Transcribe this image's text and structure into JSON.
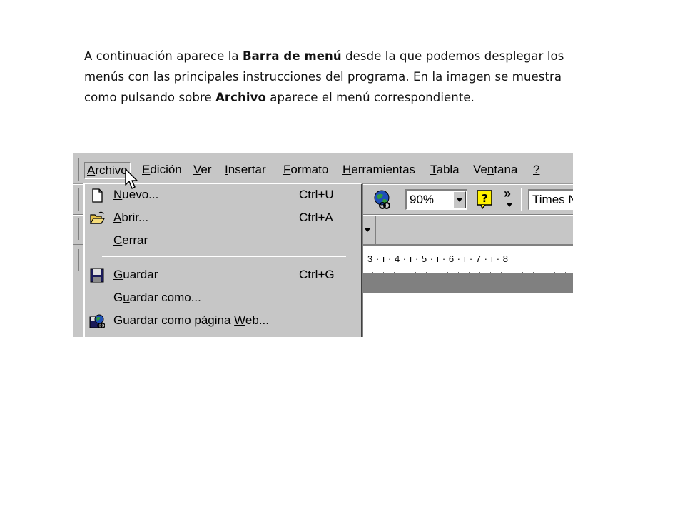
{
  "paragraph": {
    "part1": "A continuación aparece la ",
    "bold1": "Barra de menú",
    "part2": " desde la que podemos desplegar los menús con las principales instrucciones del programa. En la imagen se muestra como pulsando sobre ",
    "bold2": "Archivo",
    "part3": " aparece el menú correspondiente."
  },
  "menubar": {
    "items": [
      {
        "pre": "",
        "u": "A",
        "post": "rchivo"
      },
      {
        "pre": "",
        "u": "E",
        "post": "dición"
      },
      {
        "pre": "",
        "u": "V",
        "post": "er"
      },
      {
        "pre": "",
        "u": "I",
        "post": "nsertar"
      },
      {
        "pre": "",
        "u": "F",
        "post": "ormato"
      },
      {
        "pre": "",
        "u": "H",
        "post": "erramientas"
      },
      {
        "pre": "",
        "u": "T",
        "post": "abla"
      },
      {
        "pre": "Ve",
        "u": "n",
        "post": "tana"
      },
      {
        "pre": "",
        "u": "?",
        "post": ""
      }
    ]
  },
  "toolbar": {
    "zoom": "90%",
    "font": "Times N",
    "overflow": "»"
  },
  "ruler": {
    "text": "3 · ı · 4 · ı · 5 · ı · 6 · ı · 7 · ı · 8"
  },
  "file_menu": {
    "items": [
      {
        "pre": "",
        "u": "N",
        "post": "uevo...",
        "shortcut": "Ctrl+U",
        "icon": "new-document-icon"
      },
      {
        "pre": "",
        "u": "A",
        "post": "brir...",
        "shortcut": "Ctrl+A",
        "icon": "open-folder-icon"
      },
      {
        "pre": "",
        "u": "C",
        "post": "errar",
        "shortcut": "",
        "icon": ""
      },
      {
        "pre": "",
        "u": "G",
        "post": "uardar",
        "shortcut": "Ctrl+G",
        "icon": "floppy-disk-icon"
      },
      {
        "pre": "G",
        "u": "u",
        "post": "ardar como...",
        "shortcut": "",
        "icon": ""
      },
      {
        "pre": "Guardar como página ",
        "u": "W",
        "post": "eb...",
        "shortcut": "",
        "icon": "web-page-icon"
      }
    ]
  }
}
